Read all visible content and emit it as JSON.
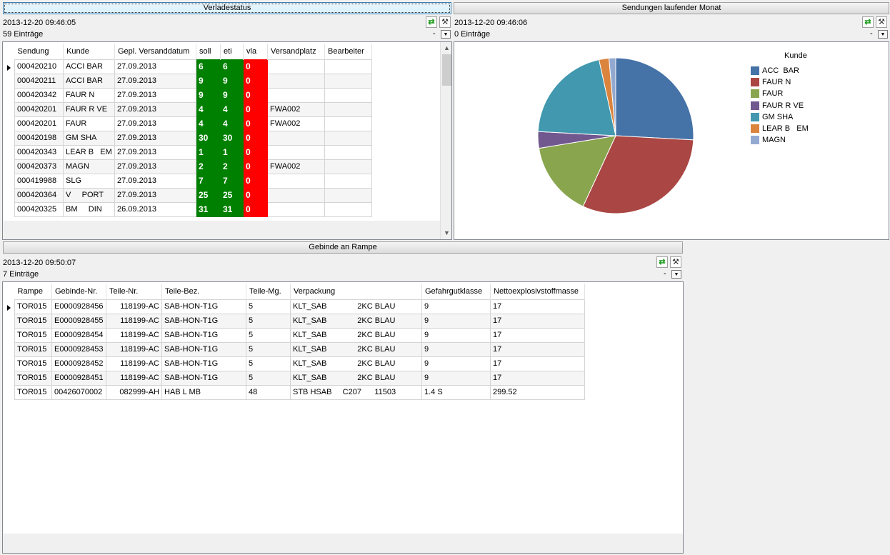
{
  "panels": {
    "verladestatus": {
      "title": "Verladestatus",
      "timestamp": "2013-12-20 09:46:05",
      "count": "59 Einträge",
      "dash": "-",
      "columns": [
        "Sendung",
        "Kunde",
        "Gepl. Versanddatum",
        "soll",
        "eti",
        "vla",
        "Versandplatz",
        "Bearbeiter"
      ],
      "rows": [
        [
          "000420210",
          "ACCI BAR",
          "27.09.2013",
          "6",
          "6",
          "0",
          "",
          ""
        ],
        [
          "000420211",
          "ACCI BAR",
          "27.09.2013",
          "9",
          "9",
          "0",
          "",
          ""
        ],
        [
          "000420342",
          "FAUR N",
          "27.09.2013",
          "9",
          "9",
          "0",
          "",
          ""
        ],
        [
          "000420201",
          "FAUR R VE",
          "27.09.2013",
          "4",
          "4",
          "0",
          "FWA002",
          ""
        ],
        [
          "000420201",
          "FAUR",
          "27.09.2013",
          "4",
          "4",
          "0",
          "FWA002",
          ""
        ],
        [
          "000420198",
          "GM SHA",
          "27.09.2013",
          "30",
          "30",
          "0",
          "",
          ""
        ],
        [
          "000420343",
          "LEAR B   EM",
          "27.09.2013",
          "1",
          "1",
          "0",
          "",
          ""
        ],
        [
          "000420373",
          "MAGN",
          "27.09.2013",
          "2",
          "2",
          "0",
          "FWA002",
          ""
        ],
        [
          "000419988",
          "SLG",
          "27.09.2013",
          "7",
          "7",
          "0",
          "",
          ""
        ],
        [
          "000420364",
          "V     PORT",
          "27.09.2013",
          "25",
          "25",
          "0",
          "",
          ""
        ],
        [
          "000420325",
          "BM     DIN",
          "26.09.2013",
          "31",
          "31",
          "0",
          "",
          ""
        ]
      ]
    },
    "sendungen": {
      "title": "Sendungen laufender Monat",
      "timestamp": "2013-12-20 09:46:06",
      "count": "0 Einträge",
      "dash": "-"
    },
    "gebinde": {
      "title": "Gebinde an Rampe",
      "timestamp": "2013-12-20 09:50:07",
      "count": "7 Einträge",
      "dash": "-",
      "columns": [
        "Rampe",
        "Gebinde-Nr.",
        "Teile-Nr.",
        "Teile-Bez.",
        "Teile-Mg.",
        "Verpackung",
        "Gefahrgutklasse",
        "Nettoexplosivstoffmasse"
      ],
      "rows": [
        [
          "TOR015",
          "E0000928456",
          "118199-AC",
          "SAB-HON-T1G",
          "5",
          "KLT_SAB              2KC BLAU",
          "9",
          "17"
        ],
        [
          "TOR015",
          "E0000928455",
          "118199-AC",
          "SAB-HON-T1G",
          "5",
          "KLT_SAB              2KC BLAU",
          "9",
          "17"
        ],
        [
          "TOR015",
          "E0000928454",
          "118199-AC",
          "SAB-HON-T1G",
          "5",
          "KLT_SAB              2KC BLAU",
          "9",
          "17"
        ],
        [
          "TOR015",
          "E0000928453",
          "118199-AC",
          "SAB-HON-T1G",
          "5",
          "KLT_SAB              2KC BLAU",
          "9",
          "17"
        ],
        [
          "TOR015",
          "E0000928452",
          "118199-AC",
          "SAB-HON-T1G",
          "5",
          "KLT_SAB              2KC BLAU",
          "9",
          "17"
        ],
        [
          "TOR015",
          "E0000928451",
          "118199-AC",
          "SAB-HON-T1G",
          "5",
          "KLT_SAB              2KC BLAU",
          "9",
          "17"
        ],
        [
          "TOR015",
          "00426070002",
          "082999-AH",
          "HAB L MB",
          "48",
          "STB HSAB     C207      11503",
          "1.4 S",
          "299.52"
        ]
      ]
    }
  },
  "chart_data": {
    "type": "pie",
    "legend_title": "Kunde",
    "legend_position": "right",
    "categories": [
      "ACC  BAR",
      "FAUR N",
      "FAUR",
      "FAUR R VE",
      "GM SHA",
      "LEAR B   EM",
      "MAGN"
    ],
    "values": [
      15,
      18,
      9,
      2,
      12,
      1.2,
      0.8
    ],
    "colors": [
      "#4572a7",
      "#aa4643",
      "#89a54e",
      "#71588f",
      "#4198af",
      "#db843d",
      "#93a9cf"
    ]
  },
  "icons": {
    "refresh": "⇄",
    "tools": "⚒",
    "dropdown": "▼",
    "scroll_up": "▲",
    "scroll_down": "▼"
  }
}
